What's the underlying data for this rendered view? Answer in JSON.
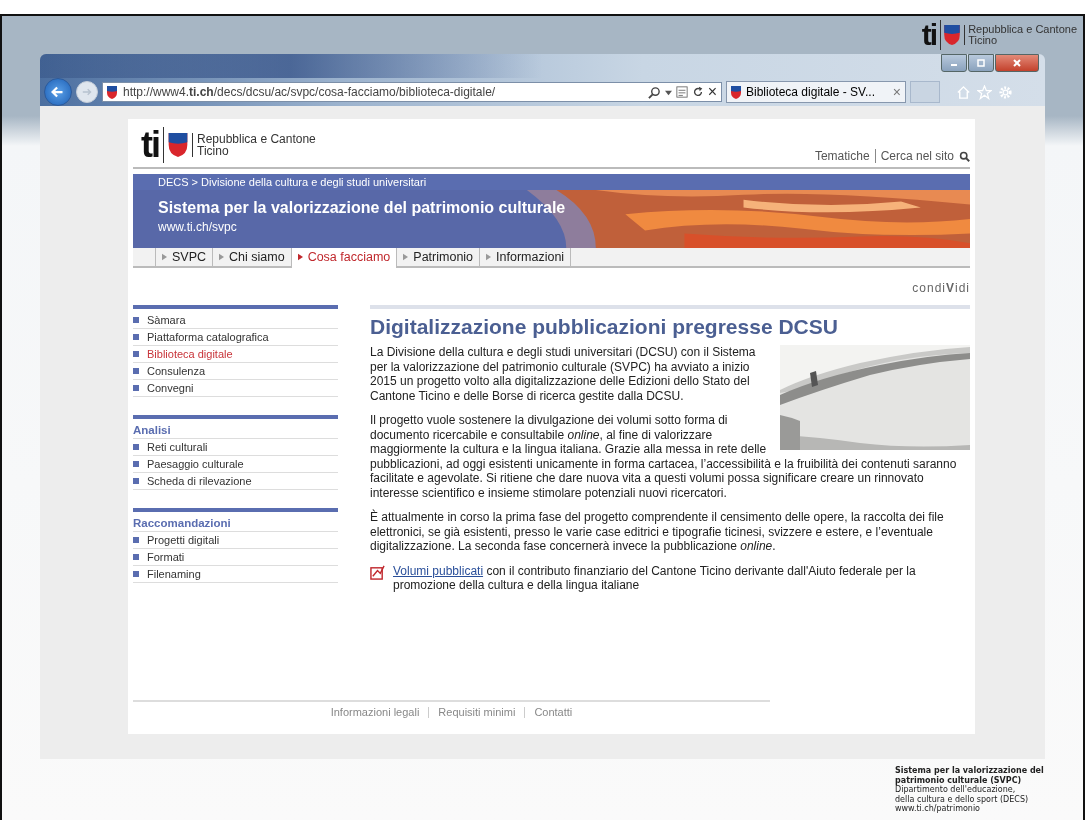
{
  "slide": {
    "logo": {
      "mark": "ti",
      "line1": "Repubblica e Cantone",
      "line2": "Ticino"
    },
    "caption": {
      "title": "Sistema per la valorizzazione del patrimonio culturale (SVPC)",
      "lines": [
        "Dipartimento dell'educazione,",
        "della cultura e dello sport (DECS)",
        "www.ti.ch/patrimonio"
      ]
    }
  },
  "browser": {
    "url": "http://www4.**ti.ch**/decs/dcsu/ac/svpc/cosa-facciamo/biblioteca-digitale/",
    "tab_title": "Biblioteca digitale - SV...",
    "tab_close": "×",
    "address_close": "×"
  },
  "page": {
    "logo": {
      "mark": "ti",
      "line1": "Repubblica e Cantone",
      "line2": "Ticino"
    },
    "header_links": [
      "Tematiche",
      "Cerca nel sito"
    ],
    "breadcrumb": "DECS > Divisione della cultura e degli studi universitari",
    "banner": {
      "title": "Sistema per la valorizzazione del patrimonio culturale",
      "subtitle": "www.ti.ch/svpc"
    },
    "nav_tabs": [
      {
        "label": "SVPC",
        "selected": false
      },
      {
        "label": "Chi siamo",
        "selected": false
      },
      {
        "label": "Cosa facciamo",
        "selected": true
      },
      {
        "label": "Patrimonio",
        "selected": false
      },
      {
        "label": "Informazioni",
        "selected": false
      }
    ],
    "share": "condi**V**idi",
    "sidebar": [
      {
        "items": [
          {
            "label": "Sàmara",
            "selected": false
          },
          {
            "label": "Piattaforma catalografica",
            "selected": false
          },
          {
            "label": "Biblioteca digitale",
            "selected": true
          },
          {
            "label": "Consulenza",
            "selected": false
          },
          {
            "label": "Convegni",
            "selected": false
          }
        ]
      },
      {
        "heading": "Analisi",
        "items": [
          {
            "label": "Reti culturali",
            "selected": false
          },
          {
            "label": "Paesaggio culturale",
            "selected": false
          },
          {
            "label": "Scheda di rilevazione",
            "selected": false
          }
        ]
      },
      {
        "heading": "Raccomandazioni",
        "items": [
          {
            "label": "Progetti digitali",
            "selected": false
          },
          {
            "label": "Formati",
            "selected": false
          },
          {
            "label": "Filenaming",
            "selected": false
          }
        ]
      }
    ],
    "article": {
      "title": "Digitalizzazione pubblicazioni pregresse DCSU",
      "paragraphs": [
        "La Divisione della cultura e degli studi universitari (DCSU) con il Sistema per la valorizzazione del patrimonio culturale (SVPC) ha avviato a inizio 2015 un progetto volto alla digitalizzazione delle Edizioni dello Stato del Cantone Ticino e delle Borse di ricerca gestite dalla DCSU.",
        "Il progetto vuole sostenere la divulgazione dei volumi sotto forma di documento ricercabile e consultabile *online*, al fine di valorizzare maggiormente la cultura e la lingua italiana. Grazie alla messa in rete delle pubblicazioni, ad oggi esistenti unicamente in forma cartacea, l’accessibilità e la fruibilità dei contenuti saranno facilitate e agevolate. Si ritiene che dare nuova vita a questi volumi possa significare creare un rinnovato interesse scientifico e insieme stimolare potenziali nuovi ricercatori.",
        "È attualmente in corso la prima fase del progetto comprendente il censimento delle opere, la raccolta dei file elettronici, se già esistenti, presso le varie case editrici e tipografie ticinesi, svizzere e estere, e l’eventuale digitalizzazione. La seconda fase concernerà invece la pubblicazione *online*."
      ],
      "link": {
        "label": "Volumi pubblicati",
        "text": " con il contributo finanziario del Cantone Ticino derivante dall'Aiuto federale per la promozione della cultura e della lingua italiane"
      }
    },
    "footer_links": [
      "Informazioni legali",
      "Requisiti minimi",
      "Contatti"
    ]
  }
}
